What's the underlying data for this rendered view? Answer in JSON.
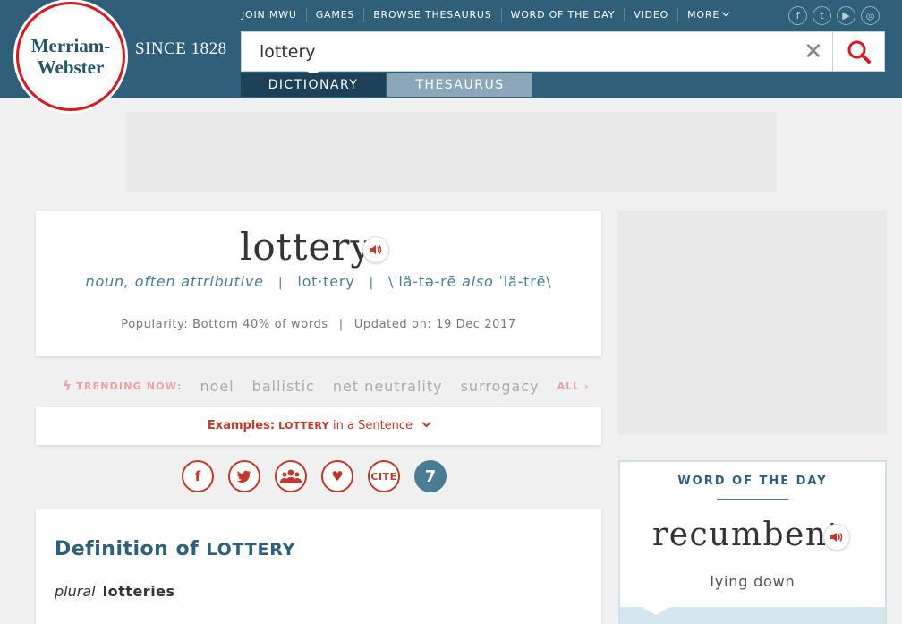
{
  "header": {
    "logo_line1": "Merriam-",
    "logo_line2": "Webster",
    "since": "SINCE 1828",
    "nav": [
      "JOIN MWU",
      "GAMES",
      "BROWSE THESAURUS",
      "WORD OF THE DAY",
      "VIDEO",
      "MORE"
    ],
    "social_icons": [
      "facebook-icon",
      "twitter-icon",
      "youtube-icon",
      "instagram-icon"
    ]
  },
  "search": {
    "value": "lottery",
    "clear_glyph": "✕"
  },
  "tabs": {
    "dictionary": "DICTIONARY",
    "thesaurus": "THESAURUS"
  },
  "entry": {
    "headword": "lottery",
    "function_label": "noun, often attributive",
    "syllables": "lot·tery",
    "pron_1": "\\ˈlä-tə-rē",
    "pron_also": "also",
    "pron_2": "ˈlä-trē\\",
    "popularity": "Popularity: Bottom 40% of words",
    "updated": "Updated on: 19 Dec 2017"
  },
  "trending": {
    "label": "TRENDING NOW:",
    "words": [
      "noel",
      "ballistic",
      "net neutrality",
      "surrogacy"
    ],
    "all": "ALL"
  },
  "examples": {
    "prefix": "Examples:",
    "word": "LOTTERY",
    "suffix": "in a Sentence"
  },
  "share": {
    "cite": "CITE",
    "t7": "7"
  },
  "definition": {
    "title": "Definition of",
    "headword": "LOTTERY",
    "plural_label": "plural",
    "plural_form": "lotteries"
  },
  "wotd": {
    "label": "WORD OF THE DAY",
    "word": "recumbent",
    "def": "lying down"
  },
  "colors": {
    "header_bg": "#305f7a",
    "accent_red": "#c0392b",
    "link_blue": "#4a7d95"
  }
}
